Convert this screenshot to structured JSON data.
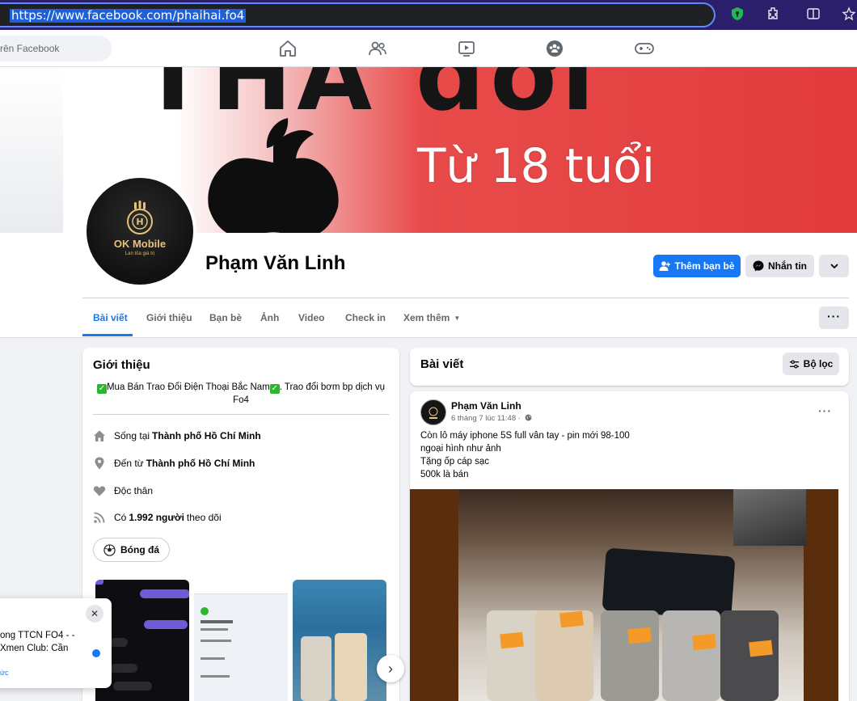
{
  "browser": {
    "url": "https://www.facebook.com/phaihai.fo4"
  },
  "fb_nav": {
    "search_text": "rên Facebook",
    "icons": [
      "home-icon",
      "friends-icon",
      "watch-icon",
      "groups-icon",
      "gaming-icon"
    ]
  },
  "cover": {
    "top_text": "THA đời",
    "age_text": "Từ 18 tuổi"
  },
  "avatar": {
    "brand": "OK Mobile",
    "slogan": "Lan tỏa giá trị"
  },
  "profile": {
    "name": "Phạm Văn Linh",
    "add_friend_label": "Thêm bạn bè",
    "message_label": "Nhắn tin"
  },
  "tabs": [
    "Bài viết",
    "Giới thiệu",
    "Bạn bè",
    "Ảnh",
    "Video",
    "Check in",
    "Xem thêm"
  ],
  "intro": {
    "title": "Giới thiệu",
    "bio_part1": "Mua Bán Trao Đổi Điện Thoại Bắc Nam",
    "bio_part2": ". Trao đổi bơm bp dịch vụ Fo4",
    "lives_prefix": "Sống tại",
    "lives_city": "Thành phố Hồ Chí Minh",
    "from_prefix": "Đến từ",
    "from_city": "Thành phố Hồ Chí Minh",
    "relationship": "Độc thân",
    "followers_prefix": "Có",
    "followers_count": "1.992 người",
    "followers_suffix": "theo dõi",
    "hobby": "Bóng đá"
  },
  "posts": {
    "title": "Bài viết",
    "filter_label": "Bộ lọc",
    "post": {
      "author": "Phạm Văn Linh",
      "meta": "6 tháng 7 lúc 11:48 ·",
      "lines": [
        "Còn lô máy iphone 5S full vân tay - pin mới 98-100",
        "ngoại hình như ảnh",
        "Tặng ốp cáp sạc",
        "500k là bán"
      ]
    }
  },
  "notification": {
    "text": "ong TTCN FO4 - - Xmen Club: Cần",
    "link": "ức"
  },
  "colors": {
    "brand_blue": "#1877f2",
    "cover_red": "#e23b3b",
    "browser_purple": "#2b1f6b"
  }
}
